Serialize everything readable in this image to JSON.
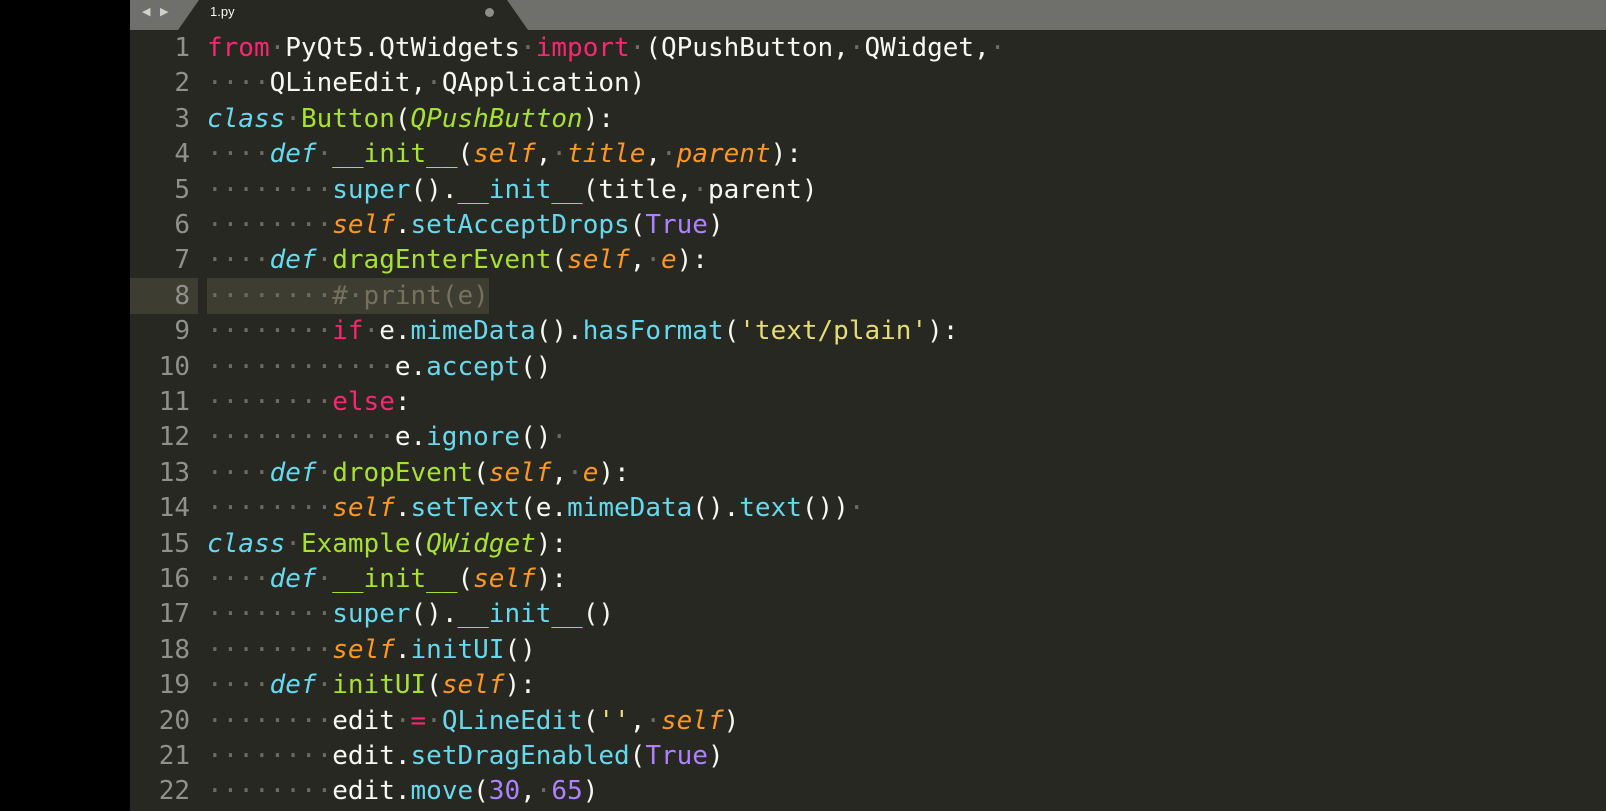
{
  "tab": {
    "nav_prev": "◀",
    "nav_next": "▶",
    "filename": "1.py"
  },
  "editor": {
    "theme_colors": {
      "background": "#272822",
      "keyword": "#f92672",
      "storage": "#66d9ef",
      "function": "#a6e22e",
      "parameter": "#fd971f",
      "constant": "#ae81ff",
      "string": "#e6db74",
      "comment": "#75715e"
    },
    "current_line": 8,
    "lines": [
      {
        "n": "1",
        "tokens": [
          [
            "kw",
            "from"
          ],
          [
            "ws",
            "·"
          ],
          [
            "",
            "PyQt5.QtWidgets"
          ],
          [
            "ws",
            "·"
          ],
          [
            "kw",
            "import"
          ],
          [
            "ws",
            "·"
          ],
          [
            "",
            "(QPushButton,"
          ],
          [
            "ws",
            "·"
          ],
          [
            "",
            "QWidget,"
          ],
          [
            "ws",
            "·"
          ]
        ]
      },
      {
        "n": "2",
        "tokens": [
          [
            "ws",
            "····"
          ],
          [
            "",
            "QLineEdit,"
          ],
          [
            "ws",
            "·"
          ],
          [
            "",
            "QApplication)"
          ]
        ]
      },
      {
        "n": "3",
        "tokens": [
          [
            "st",
            "class"
          ],
          [
            "ws",
            "·"
          ],
          [
            "fn",
            "Button"
          ],
          [
            "",
            "("
          ],
          [
            "cl",
            "QPushButton"
          ],
          [
            "",
            "):"
          ]
        ]
      },
      {
        "n": "4",
        "tokens": [
          [
            "ws",
            "····"
          ],
          [
            "st",
            "def"
          ],
          [
            "ws",
            "·"
          ],
          [
            "fn",
            "__init__"
          ],
          [
            "",
            "("
          ],
          [
            "pa",
            "self"
          ],
          [
            "",
            ","
          ],
          [
            "ws",
            "·"
          ],
          [
            "pa",
            "title"
          ],
          [
            "",
            ","
          ],
          [
            "ws",
            "·"
          ],
          [
            "pa",
            "parent"
          ],
          [
            "",
            "):"
          ]
        ]
      },
      {
        "n": "5",
        "tokens": [
          [
            "ws",
            "········"
          ],
          [
            "bi",
            "super"
          ],
          [
            "",
            "()."
          ],
          [
            "bi",
            "__init__"
          ],
          [
            "",
            "(title,"
          ],
          [
            "ws",
            "·"
          ],
          [
            "",
            "parent)"
          ]
        ]
      },
      {
        "n": "6",
        "tokens": [
          [
            "ws",
            "········"
          ],
          [
            "pa",
            "self"
          ],
          [
            "",
            "."
          ],
          [
            "bi",
            "setAcceptDrops"
          ],
          [
            "",
            "("
          ],
          [
            "co",
            "True"
          ],
          [
            "",
            ")"
          ]
        ]
      },
      {
        "n": "7",
        "tokens": [
          [
            "ws",
            "····"
          ],
          [
            "st",
            "def"
          ],
          [
            "ws",
            "·"
          ],
          [
            "fn",
            "dragEnterEvent"
          ],
          [
            "",
            "("
          ],
          [
            "pa",
            "self"
          ],
          [
            "",
            ","
          ],
          [
            "ws",
            "·"
          ],
          [
            "pa",
            "e"
          ],
          [
            "",
            "):"
          ]
        ]
      },
      {
        "n": "8",
        "tokens": [
          [
            "ws",
            "········"
          ],
          [
            "cm",
            "#"
          ],
          [
            "ws",
            "·"
          ],
          [
            "cm",
            "print(e)"
          ]
        ]
      },
      {
        "n": "9",
        "tokens": [
          [
            "ws",
            "········"
          ],
          [
            "kw",
            "if"
          ],
          [
            "ws",
            "·"
          ],
          [
            "",
            "e."
          ],
          [
            "bi",
            "mimeData"
          ],
          [
            "",
            "()."
          ],
          [
            "bi",
            "hasFormat"
          ],
          [
            "",
            "("
          ],
          [
            "str",
            "'text/plain'"
          ],
          [
            "",
            "):"
          ]
        ]
      },
      {
        "n": "10",
        "tokens": [
          [
            "ws",
            "············"
          ],
          [
            "",
            "e."
          ],
          [
            "bi",
            "accept"
          ],
          [
            "",
            "()"
          ]
        ]
      },
      {
        "n": "11",
        "tokens": [
          [
            "ws",
            "········"
          ],
          [
            "kw",
            "else"
          ],
          [
            "",
            ":"
          ]
        ]
      },
      {
        "n": "12",
        "tokens": [
          [
            "ws",
            "············"
          ],
          [
            "",
            "e."
          ],
          [
            "bi",
            "ignore"
          ],
          [
            "",
            "()"
          ],
          [
            "ws",
            "·"
          ]
        ]
      },
      {
        "n": "13",
        "tokens": [
          [
            "ws",
            "····"
          ],
          [
            "st",
            "def"
          ],
          [
            "ws",
            "·"
          ],
          [
            "fn",
            "dropEvent"
          ],
          [
            "",
            "("
          ],
          [
            "pa",
            "self"
          ],
          [
            "",
            ","
          ],
          [
            "ws",
            "·"
          ],
          [
            "pa",
            "e"
          ],
          [
            "",
            "):"
          ]
        ]
      },
      {
        "n": "14",
        "tokens": [
          [
            "ws",
            "········"
          ],
          [
            "pa",
            "self"
          ],
          [
            "",
            "."
          ],
          [
            "bi",
            "setText"
          ],
          [
            "",
            "(e."
          ],
          [
            "bi",
            "mimeData"
          ],
          [
            "",
            "()."
          ],
          [
            "bi",
            "text"
          ],
          [
            "",
            "())"
          ],
          [
            "ws",
            "·"
          ]
        ]
      },
      {
        "n": "15",
        "tokens": [
          [
            "st",
            "class"
          ],
          [
            "ws",
            "·"
          ],
          [
            "fn",
            "Example"
          ],
          [
            "",
            "("
          ],
          [
            "cl",
            "QWidget"
          ],
          [
            "",
            "):"
          ]
        ]
      },
      {
        "n": "16",
        "tokens": [
          [
            "ws",
            "····"
          ],
          [
            "st",
            "def"
          ],
          [
            "ws",
            "·"
          ],
          [
            "fn",
            "__init__"
          ],
          [
            "",
            "("
          ],
          [
            "pa",
            "self"
          ],
          [
            "",
            "):"
          ]
        ]
      },
      {
        "n": "17",
        "tokens": [
          [
            "ws",
            "········"
          ],
          [
            "bi",
            "super"
          ],
          [
            "",
            "()."
          ],
          [
            "bi",
            "__init__"
          ],
          [
            "",
            "()"
          ]
        ]
      },
      {
        "n": "18",
        "tokens": [
          [
            "ws",
            "········"
          ],
          [
            "pa",
            "self"
          ],
          [
            "",
            "."
          ],
          [
            "bi",
            "initUI"
          ],
          [
            "",
            "()"
          ]
        ]
      },
      {
        "n": "19",
        "tokens": [
          [
            "ws",
            "····"
          ],
          [
            "st",
            "def"
          ],
          [
            "ws",
            "·"
          ],
          [
            "fn",
            "initUI"
          ],
          [
            "",
            "("
          ],
          [
            "pa",
            "self"
          ],
          [
            "",
            "):"
          ]
        ]
      },
      {
        "n": "20",
        "tokens": [
          [
            "ws",
            "········"
          ],
          [
            "",
            "edit"
          ],
          [
            "ws",
            "·"
          ],
          [
            "kw",
            "="
          ],
          [
            "ws",
            "·"
          ],
          [
            "bi",
            "QLineEdit"
          ],
          [
            "",
            "("
          ],
          [
            "str",
            "''"
          ],
          [
            "",
            ","
          ],
          [
            "ws",
            "·"
          ],
          [
            "pa",
            "self"
          ],
          [
            "",
            ")"
          ]
        ]
      },
      {
        "n": "21",
        "tokens": [
          [
            "ws",
            "········"
          ],
          [
            "",
            "edit."
          ],
          [
            "bi",
            "setDragEnabled"
          ],
          [
            "",
            "("
          ],
          [
            "co",
            "True"
          ],
          [
            "",
            ")"
          ]
        ]
      },
      {
        "n": "22",
        "tokens": [
          [
            "ws",
            "········"
          ],
          [
            "",
            "edit."
          ],
          [
            "bi",
            "move"
          ],
          [
            "",
            "("
          ],
          [
            "co",
            "30"
          ],
          [
            "",
            ","
          ],
          [
            "ws",
            "·"
          ],
          [
            "co",
            "65"
          ],
          [
            "",
            ")"
          ]
        ]
      }
    ]
  }
}
